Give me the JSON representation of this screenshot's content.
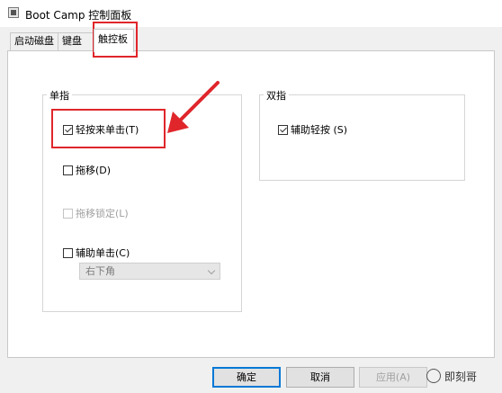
{
  "window": {
    "title": "Boot Camp 控制面板"
  },
  "tabs": [
    {
      "label": "启动磁盘"
    },
    {
      "label": "键盘"
    },
    {
      "label": "触控板"
    }
  ],
  "single_finger": {
    "title": "单指",
    "items": [
      {
        "label": "轻按来单击(T)",
        "checked": true,
        "enabled": true
      },
      {
        "label": "拖移(D)",
        "checked": false,
        "enabled": true
      },
      {
        "label": "拖移锁定(L)",
        "checked": false,
        "enabled": false
      },
      {
        "label": "辅助单击(C)",
        "checked": false,
        "enabled": true
      }
    ],
    "secondary_click_select": {
      "value": "右下角"
    }
  },
  "two_finger": {
    "title": "双指",
    "items": [
      {
        "label": "辅助轻按 (S)",
        "checked": true,
        "enabled": true
      }
    ]
  },
  "buttons": {
    "ok": "确定",
    "cancel": "取消",
    "apply": "应用(A)"
  },
  "watermark": {
    "text": "即刻哥"
  },
  "colors": {
    "highlight": "#e0262b",
    "default_button_border": "#0078d7"
  }
}
